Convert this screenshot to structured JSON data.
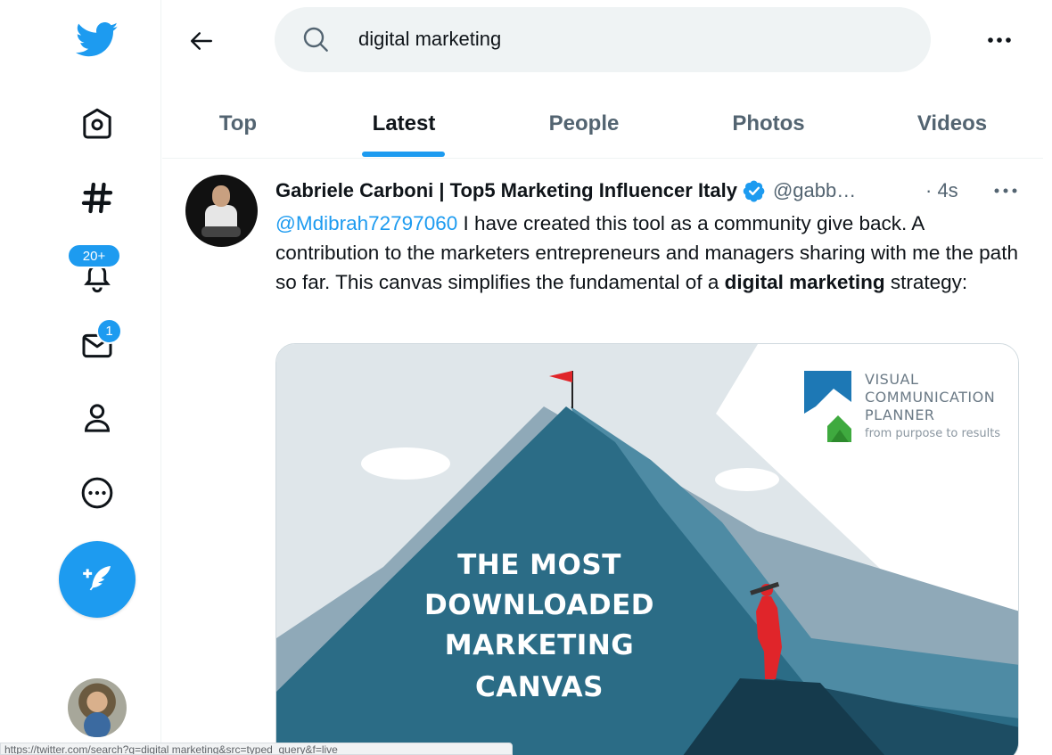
{
  "search": {
    "query": "digital marketing"
  },
  "notifications": {
    "badge": "20+"
  },
  "messages": {
    "badge": "1"
  },
  "tabs": [
    {
      "label": "Top"
    },
    {
      "label": "Latest"
    },
    {
      "label": "People"
    },
    {
      "label": "Photos"
    },
    {
      "label": "Videos"
    }
  ],
  "tweet": {
    "author": "Gabriele Carboni | Top5 Marketing Influencer Italy",
    "handle": "@gabb…",
    "time": "· 4s",
    "mention": "@Mdibrah72797060",
    "text_1": " I have created this tool as a community give back. A contribution to the marketers entrepreneurs and managers sharing with me the path so far. This canvas simplifies the fundamental of a ",
    "bold": "digital marketing",
    "text_2": " strategy:",
    "media": {
      "headline_lines": [
        "THE MOST",
        "DOWNLOADED",
        "MARKETING",
        "CANVAS"
      ],
      "logo_lines": [
        "VISUAL",
        "COMMUNICATION",
        "PLANNER"
      ],
      "logo_tagline": "from purpose to results"
    }
  },
  "status_bar": {
    "url": "https://twitter.com/search?q=digital marketing&src=typed_query&f=live"
  },
  "colors": {
    "accent": "#1d9bf0",
    "mountain": "#2b6c86",
    "sky": "#dfe6ea",
    "flag": "#e0252a"
  }
}
